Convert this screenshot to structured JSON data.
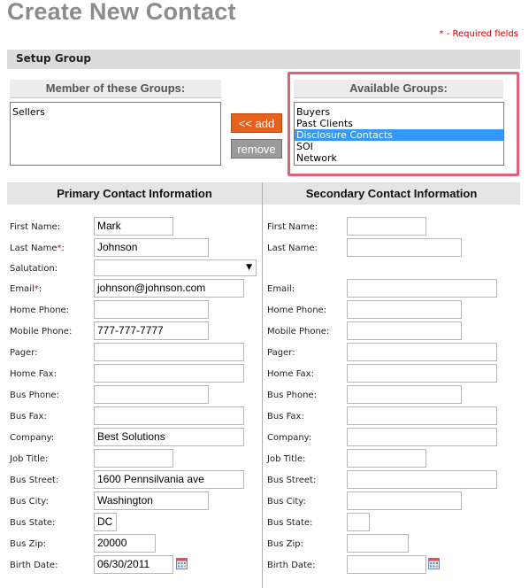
{
  "page": {
    "title": "Create New Contact",
    "required_note": "* - Required fields"
  },
  "setup_group": {
    "heading": "Setup Group",
    "member_heading": "Member of these Groups:",
    "member_items": [
      "Sellers"
    ],
    "available_heading": "Available Groups:",
    "available_items": [
      "Buyers",
      "Past Clients",
      "Disclosure Contacts",
      "SOI",
      "Network"
    ],
    "available_selected": "Disclosure Contacts",
    "add_label": "<< add",
    "remove_label": "remove"
  },
  "primary": {
    "heading": "Primary Contact Information",
    "fields": {
      "first_name": {
        "label": "First Name:",
        "value": "Mark"
      },
      "last_name": {
        "label": "Last Name",
        "value": "Johnson"
      },
      "salutation": {
        "label": "Salutation:",
        "value": ""
      },
      "email": {
        "label": "Email",
        "value": "johnson@johnson.com"
      },
      "home_phone": {
        "label": "Home Phone:",
        "value": ""
      },
      "mobile_phone": {
        "label": "Mobile Phone:",
        "value": "777-777-7777"
      },
      "pager": {
        "label": "Pager:",
        "value": ""
      },
      "home_fax": {
        "label": "Home Fax:",
        "value": ""
      },
      "bus_phone": {
        "label": "Bus Phone:",
        "value": ""
      },
      "bus_fax": {
        "label": "Bus Fax:",
        "value": ""
      },
      "company": {
        "label": "Company:",
        "value": "Best Solutions"
      },
      "job_title": {
        "label": "Job Title:",
        "value": ""
      },
      "bus_street": {
        "label": "Bus Street:",
        "value": "1600 Pennsilvania ave"
      },
      "bus_city": {
        "label": "Bus City:",
        "value": "Washington"
      },
      "bus_state": {
        "label": "Bus State:",
        "value": "DC"
      },
      "bus_zip": {
        "label": "Bus Zip:",
        "value": "20000"
      },
      "birth_date": {
        "label": "Birth Date:",
        "value": "06/30/2011"
      }
    }
  },
  "secondary": {
    "heading": "Secondary Contact Information",
    "fields": {
      "first_name": {
        "label": "First Name:",
        "value": ""
      },
      "last_name": {
        "label": "Last Name:",
        "value": ""
      },
      "email": {
        "label": "Email:",
        "value": ""
      },
      "home_phone": {
        "label": "Home Phone:",
        "value": ""
      },
      "mobile_phone": {
        "label": "Mobile Phone:",
        "value": ""
      },
      "pager": {
        "label": "Pager:",
        "value": ""
      },
      "home_fax": {
        "label": "Home Fax:",
        "value": ""
      },
      "bus_phone": {
        "label": "Bus Phone:",
        "value": ""
      },
      "bus_fax": {
        "label": "Bus Fax:",
        "value": ""
      },
      "company": {
        "label": "Company:",
        "value": ""
      },
      "job_title": {
        "label": "Job Title:",
        "value": ""
      },
      "bus_street": {
        "label": "Bus Street:",
        "value": ""
      },
      "bus_city": {
        "label": "Bus City:",
        "value": ""
      },
      "bus_state": {
        "label": "Bus State:",
        "value": ""
      },
      "bus_zip": {
        "label": "Bus Zip:",
        "value": ""
      },
      "birth_date": {
        "label": "Birth Date:",
        "value": ""
      }
    }
  },
  "colors": {
    "accent_button": "#e8611a",
    "highlight_frame": "#e0607a",
    "selection": "#3399ff",
    "required_star": "#cc0000"
  },
  "icons": {
    "date_picker": "calendar-icon"
  }
}
